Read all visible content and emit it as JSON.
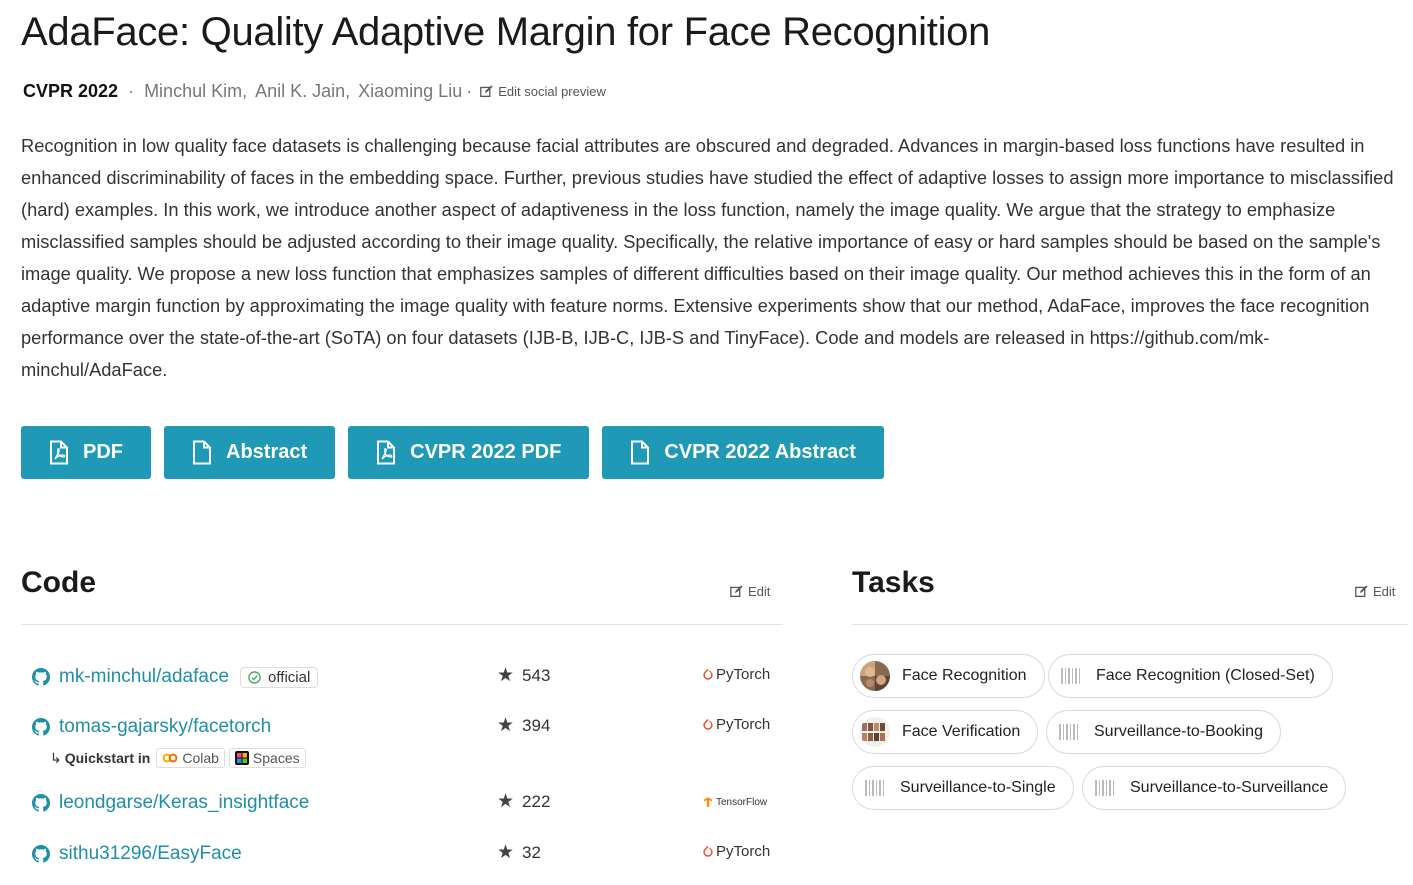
{
  "paper": {
    "title": "AdaFace: Quality Adaptive Margin for Face Recognition",
    "conference": "CVPR 2022",
    "authors": [
      "Minchul Kim,",
      "Anil K. Jain,",
      "Xiaoming Liu"
    ],
    "author_sep": "·",
    "edit_preview_label": "Edit social preview",
    "abstract": "Recognition in low quality face datasets is challenging because facial attributes are obscured and degraded. Advances in margin-based loss functions have resulted in enhanced discriminability of faces in the embedding space. Further, previous studies have studied the effect of adaptive losses to assign more importance to misclassified (hard) examples. In this work, we introduce another aspect of adaptiveness in the loss function, namely the image quality. We argue that the strategy to emphasize misclassified samples should be adjusted according to their image quality. Specifically, the relative importance of easy or hard samples should be based on the sample's image quality. We propose a new loss function that emphasizes samples of different difficulties based on their image quality. Our method achieves this in the form of an adaptive margin function by approximating the image quality with feature norms. Extensive experiments show that our method, AdaFace, improves the face recognition performance over the state-of-the-art (SoTA) on four datasets (IJB-B, IJB-C, IJB-S and TinyFace). Code and models are released in https://github.com/mk-minchul/AdaFace."
  },
  "buttons": [
    {
      "label": "PDF",
      "icon": "pdf-file-icon"
    },
    {
      "label": "Abstract",
      "icon": "file-icon"
    },
    {
      "label": "CVPR 2022 PDF",
      "icon": "pdf-file-icon"
    },
    {
      "label": "CVPR 2022 Abstract",
      "icon": "file-icon"
    }
  ],
  "code": {
    "heading": "Code",
    "edit_label": "Edit",
    "repos": [
      {
        "name": "mk-minchul/adaface",
        "badge": "official",
        "stars": "543",
        "framework": "PyTorch"
      },
      {
        "name": "tomas-gajarsky/facetorch",
        "stars": "394",
        "framework": "PyTorch"
      },
      {
        "name": "leondgarse/Keras_insightface",
        "stars": "222",
        "framework": "TensorFlow"
      },
      {
        "name": "sithu31296/EasyFace",
        "stars": "32",
        "framework": "PyTorch"
      }
    ],
    "quickstart": {
      "label": "Quickstart in",
      "colab": "Colab",
      "spaces": "Spaces"
    }
  },
  "tasks": {
    "heading": "Tasks",
    "edit_label": "Edit",
    "items": [
      "Face Recognition",
      "Face Recognition (Closed-Set)",
      "Face Verification",
      "Surveillance-to-Booking",
      "Surveillance-to-Single",
      "Surveillance-to-Surveillance"
    ]
  },
  "colors": {
    "accent": "#1f99b5",
    "link": "#1f8ea8",
    "pytorch": "#ee4c2c",
    "tensorflow": "#ff8f00"
  }
}
